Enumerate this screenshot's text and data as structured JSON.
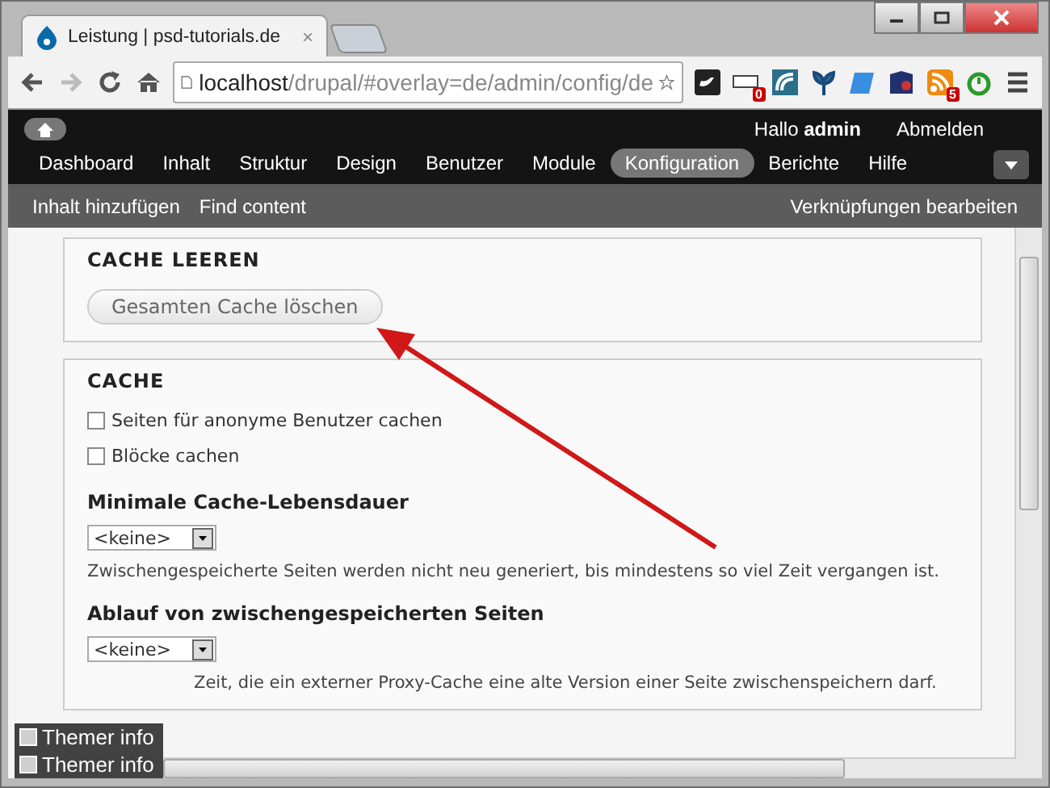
{
  "tabs": [
    {
      "label": "Leistung | psd-tutorials.de",
      "selected": true,
      "close": "×"
    }
  ],
  "address": {
    "host": "localhost",
    "path": "/drupal/#overlay=de/admin/config/de"
  },
  "extensions": [
    {
      "kind": "bird"
    },
    {
      "kind": "counter",
      "badge": "0"
    },
    {
      "kind": "wave"
    },
    {
      "kind": "plant"
    },
    {
      "kind": "note"
    },
    {
      "kind": "book"
    },
    {
      "kind": "rss",
      "badge": "5"
    },
    {
      "kind": "timer"
    }
  ],
  "admin_bar": {
    "greeting": "Hallo",
    "user": "admin",
    "logout": "Abmelden",
    "menu": [
      {
        "label": "Dashboard",
        "selected": false
      },
      {
        "label": "Inhalt",
        "selected": false
      },
      {
        "label": "Struktur",
        "selected": false
      },
      {
        "label": "Design",
        "selected": false
      },
      {
        "label": "Benutzer",
        "selected": false
      },
      {
        "label": "Module",
        "selected": false
      },
      {
        "label": "Konfiguration",
        "selected": true
      },
      {
        "label": "Berichte",
        "selected": false
      },
      {
        "label": "Hilfe",
        "selected": false
      }
    ]
  },
  "shortcuts": {
    "items": [
      "Inhalt hinzufügen",
      "Find content"
    ],
    "edit": "Verknüpfungen bearbeiten"
  },
  "fieldsets": [
    {
      "legend": "CACHE LEEREN",
      "items": [
        {
          "kind": "button",
          "label": "Gesamten Cache löschen"
        }
      ]
    },
    {
      "legend": "CACHE",
      "items": [
        {
          "kind": "checkbox",
          "label": "Seiten für anonyme Benutzer cachen",
          "checked": false
        },
        {
          "kind": "checkbox",
          "label": "Blöcke cachen",
          "checked": false
        },
        {
          "kind": "select",
          "label": "Minimale Cache-Lebensdauer",
          "value": "<keine>",
          "description": "Zwischengespeicherte Seiten werden nicht neu generiert, bis mindestens so viel Zeit vergangen ist."
        },
        {
          "kind": "select",
          "label": "Ablauf von zwischengespeicherten Seiten",
          "value": "<keine>",
          "description": "Zeit, die ein externer Proxy-Cache eine alte Version einer Seite zwischenspeichern darf."
        }
      ]
    }
  ],
  "themer": [
    "Themer info",
    "Themer info"
  ]
}
